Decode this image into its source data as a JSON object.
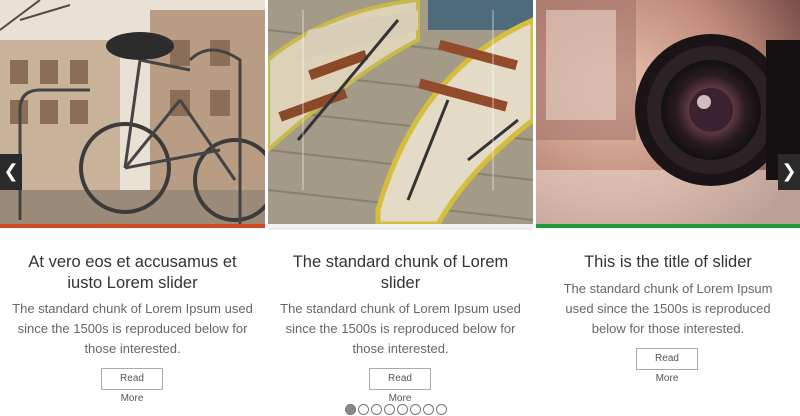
{
  "colors": {
    "accent_red": "#d14a22",
    "accent_green": "#1d9a3a"
  },
  "navigation": {
    "prev_icon": "chevron-left-icon",
    "next_icon": "chevron-right-icon",
    "prev_glyph": "❮",
    "next_glyph": "❯"
  },
  "slides": [
    {
      "title": "At vero eos et accusamus et iusto Lorem slider",
      "description": "The standard chunk of Lorem Ipsum used since the 1500s is reproduced below for those interested.",
      "button_label": "Read More",
      "image": "bicycle-photo"
    },
    {
      "title": "The standard chunk of Lorem slider",
      "description": "The standard chunk of Lorem Ipsum used since the 1500s is reproduced below for those interested.",
      "button_label": "Read More",
      "image": "rowboats-photo"
    },
    {
      "title": "This is the title of slider",
      "description": "The standard chunk of Lorem Ipsum used since the 1500s is reproduced below for those interested.",
      "button_label": "Read More",
      "image": "camera-lens-photo"
    }
  ],
  "pagination": {
    "count": 8,
    "active_index": 0
  }
}
